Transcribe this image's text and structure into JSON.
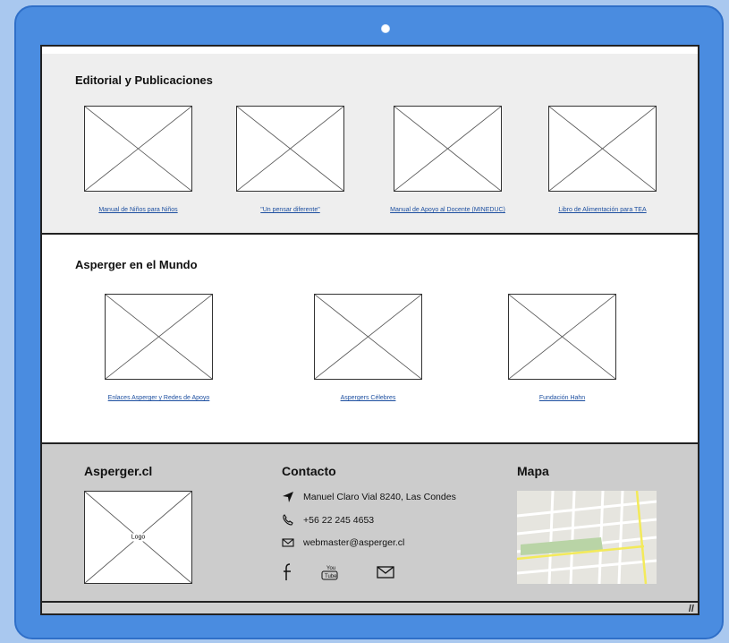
{
  "editorial": {
    "title": "Editorial y Publicaciones",
    "items": [
      {
        "label": "Manual de Niños para Niños"
      },
      {
        "label": "\"Un pensar diferente\""
      },
      {
        "label": "Manual de Apoyo al Docente (MINEDUC)"
      },
      {
        "label": "Libro de Alimentación para TEA"
      }
    ]
  },
  "mundo": {
    "title": "Asperger en el Mundo",
    "items": [
      {
        "label": "Enlaces Asperger y Redes de Apoyo"
      },
      {
        "label": "Aspergers Célebres"
      },
      {
        "label": "Fundación Hahn"
      }
    ]
  },
  "footer": {
    "brand": "Asperger.cl",
    "logo_label": "Logo",
    "contact_title": "Contacto",
    "address": "Manuel Claro Vial 8240, Las Condes",
    "phone": "+56 22 245 4653",
    "email": "webmaster@asperger.cl",
    "map_title": "Mapa",
    "social_icons": [
      "facebook-icon",
      "youtube-icon",
      "mail-icon"
    ]
  },
  "colors": {
    "device": "#4a8ce0",
    "page_bg": "#a9c8ef",
    "section_gray": "#eeeeee",
    "footer_gray": "#cccccc",
    "link": "#1d4fa0"
  }
}
